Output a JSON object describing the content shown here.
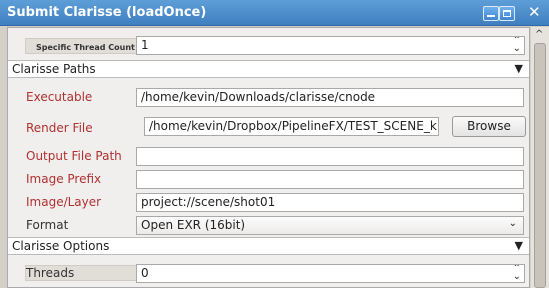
{
  "window": {
    "title": "Submit Clarisse (loadOnce)"
  },
  "rows": {
    "specific_thread_count": {
      "label": "Specific Thread Count",
      "value": "1"
    },
    "executable": {
      "label": "Executable",
      "value": "/home/kevin/Downloads/clarisse/cnode"
    },
    "render_file": {
      "label": "Render File",
      "value": "/home/kevin/Dropbox/PipelineFX/TEST_SCENE_k",
      "button": "Browse"
    },
    "output_file_path": {
      "label": "Output File Path",
      "value": ""
    },
    "image_prefix": {
      "label": "Image Prefix",
      "value": ""
    },
    "image_layer": {
      "label": "Image/Layer",
      "value": "project://scene/shot01"
    },
    "format": {
      "label": "Format",
      "value": "Open EXR (16bit)"
    },
    "threads": {
      "label": "Threads",
      "value": "0"
    }
  },
  "sections": {
    "clarisse_paths": "Clarisse Paths",
    "clarisse_options": "Clarisse Options"
  }
}
